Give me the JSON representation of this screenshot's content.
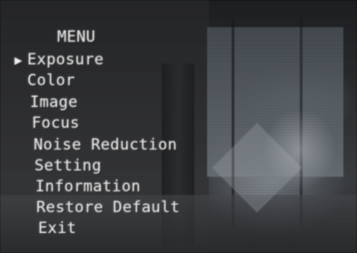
{
  "menu": {
    "title": "MENU",
    "selected_marker": "▶",
    "items": [
      {
        "label": "Exposure",
        "selected": true
      },
      {
        "label": "Color",
        "selected": false
      },
      {
        "label": "Image",
        "selected": false
      },
      {
        "label": "Focus",
        "selected": false
      },
      {
        "label": "Noise Reduction",
        "selected": false
      },
      {
        "label": "Setting",
        "selected": false
      },
      {
        "label": "Information",
        "selected": false
      },
      {
        "label": "Restore Default",
        "selected": false
      },
      {
        "label": "Exit",
        "selected": false
      }
    ]
  },
  "colors": {
    "text": "#ececec",
    "background": "#2a2c2f"
  }
}
